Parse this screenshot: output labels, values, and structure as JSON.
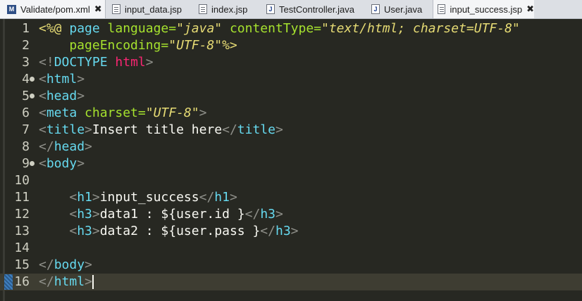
{
  "tabs": [
    {
      "label": "Validate/pom.xml",
      "icon": "maven-file-icon",
      "active": true,
      "closable": true
    },
    {
      "label": "input_data.jsp",
      "icon": "jsp-file-icon",
      "active": false,
      "closable": false
    },
    {
      "label": "index.jsp",
      "icon": "jsp-file-icon",
      "active": false,
      "closable": false
    },
    {
      "label": "TestController.java",
      "icon": "java-file-icon",
      "active": false,
      "closable": false
    },
    {
      "label": "User.java",
      "icon": "java-file-icon",
      "active": false,
      "closable": false
    },
    {
      "label": "input_success.jsp",
      "icon": "jsp-file-icon",
      "active": true,
      "closable": true
    }
  ],
  "close_glyph": "✖",
  "lines": [
    {
      "num": "1",
      "fold": false,
      "tokens": [
        [
          "<%@ ",
          "dir"
        ],
        [
          "page ",
          "tag"
        ],
        [
          "language=",
          "attr"
        ],
        [
          "\"java\" ",
          "str"
        ],
        [
          "contentType=",
          "attr"
        ],
        [
          "\"text/html; charset=UTF-8\"",
          "str"
        ]
      ]
    },
    {
      "num": "2",
      "fold": false,
      "tokens": [
        [
          "    pageEncoding=",
          "attr"
        ],
        [
          "\"UTF-8\"",
          "str"
        ],
        [
          "%>",
          "dir"
        ]
      ]
    },
    {
      "num": "3",
      "fold": false,
      "tokens": [
        [
          "<!",
          "br"
        ],
        [
          "DOCTYPE ",
          "ab"
        ],
        [
          "html",
          "doc"
        ],
        [
          ">",
          "br"
        ]
      ]
    },
    {
      "num": "4",
      "fold": true,
      "tokens": [
        [
          "<",
          "br"
        ],
        [
          "html",
          "tag"
        ],
        [
          ">",
          "br"
        ]
      ]
    },
    {
      "num": "5",
      "fold": true,
      "tokens": [
        [
          "<",
          "br"
        ],
        [
          "head",
          "tag"
        ],
        [
          ">",
          "br"
        ]
      ]
    },
    {
      "num": "6",
      "fold": false,
      "tokens": [
        [
          "<",
          "br"
        ],
        [
          "meta ",
          "tag"
        ],
        [
          "charset=",
          "attr"
        ],
        [
          "\"UTF-8\"",
          "str"
        ],
        [
          ">",
          "br"
        ]
      ]
    },
    {
      "num": "7",
      "fold": false,
      "tokens": [
        [
          "<",
          "br"
        ],
        [
          "title",
          "tag"
        ],
        [
          ">",
          "br"
        ],
        [
          "Insert title here",
          "txt"
        ],
        [
          "</",
          "br"
        ],
        [
          "title",
          "tag"
        ],
        [
          ">",
          "br"
        ]
      ]
    },
    {
      "num": "8",
      "fold": false,
      "tokens": [
        [
          "</",
          "br"
        ],
        [
          "head",
          "tag"
        ],
        [
          ">",
          "br"
        ]
      ]
    },
    {
      "num": "9",
      "fold": true,
      "tokens": [
        [
          "<",
          "br"
        ],
        [
          "body",
          "tag"
        ],
        [
          ">",
          "br"
        ]
      ]
    },
    {
      "num": "10",
      "fold": false,
      "tokens": []
    },
    {
      "num": "11",
      "fold": false,
      "tokens": [
        [
          "    <",
          "br"
        ],
        [
          "h1",
          "tag"
        ],
        [
          ">",
          "br"
        ],
        [
          "input_success",
          "txt"
        ],
        [
          "</",
          "br"
        ],
        [
          "h1",
          "tag"
        ],
        [
          ">",
          "br"
        ]
      ]
    },
    {
      "num": "12",
      "fold": false,
      "tokens": [
        [
          "    <",
          "br"
        ],
        [
          "h3",
          "tag"
        ],
        [
          ">",
          "br"
        ],
        [
          "data1 : ${user.id }",
          "txt"
        ],
        [
          "</",
          "br"
        ],
        [
          "h3",
          "tag"
        ],
        [
          ">",
          "br"
        ]
      ]
    },
    {
      "num": "13",
      "fold": false,
      "tokens": [
        [
          "    <",
          "br"
        ],
        [
          "h3",
          "tag"
        ],
        [
          ">",
          "br"
        ],
        [
          "data2 : ${user.pass }",
          "txt"
        ],
        [
          "</",
          "br"
        ],
        [
          "h3",
          "tag"
        ],
        [
          ">",
          "br"
        ]
      ]
    },
    {
      "num": "14",
      "fold": false,
      "tokens": []
    },
    {
      "num": "15",
      "fold": false,
      "tokens": [
        [
          "</",
          "br"
        ],
        [
          "body",
          "tag"
        ],
        [
          ">",
          "br"
        ]
      ]
    },
    {
      "num": "16",
      "fold": false,
      "current": true,
      "tokens": [
        [
          "</",
          "br"
        ],
        [
          "html",
          "tag"
        ],
        [
          ">",
          "br"
        ]
      ]
    }
  ]
}
